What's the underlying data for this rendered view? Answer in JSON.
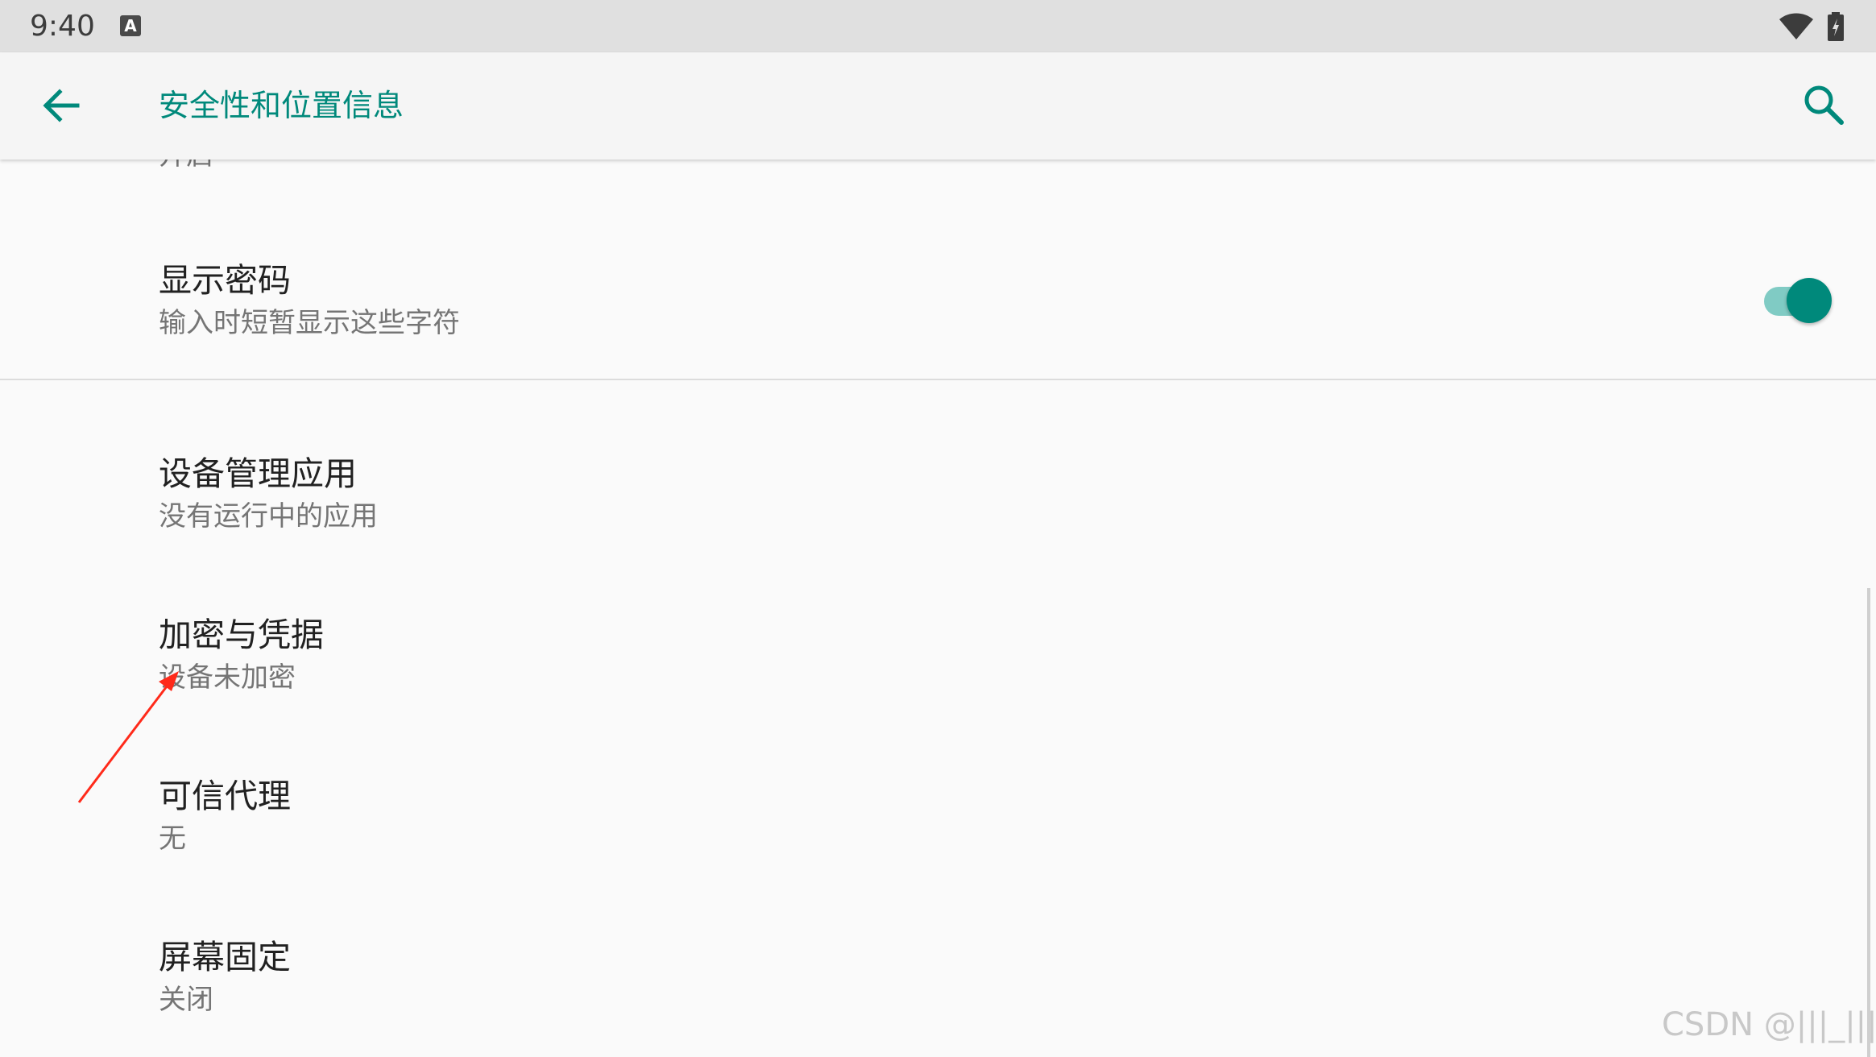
{
  "status_bar": {
    "time": "9:40",
    "ime_badge": "A",
    "icons": [
      "wifi-icon",
      "battery-charging-icon"
    ]
  },
  "toolbar": {
    "title": "安全性和位置信息",
    "back_icon": "arrow-back-icon",
    "search_icon": "search-icon",
    "accent_color": "#00897b"
  },
  "partial_item": {
    "summary": "开启"
  },
  "items": [
    {
      "title": "显示密码",
      "summary": "输入时短暂显示这些字符",
      "switch_on": true
    },
    {
      "title": "设备管理应用",
      "summary": "没有运行中的应用"
    },
    {
      "title": "加密与凭据",
      "summary": "设备未加密"
    },
    {
      "title": "可信代理",
      "summary": "无"
    },
    {
      "title": "屏幕固定",
      "summary": "关闭"
    }
  ],
  "annotation": {
    "color": "#ff2a1a"
  },
  "watermark": "CSDN @|||_|||"
}
